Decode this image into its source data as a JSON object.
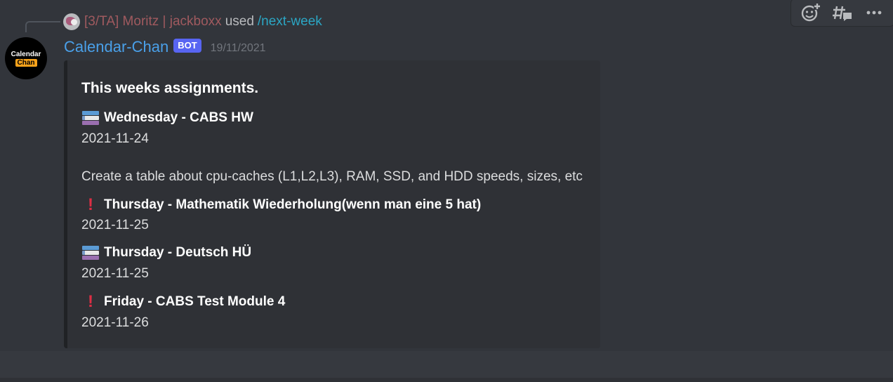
{
  "reply": {
    "user": "[3/TA] Moritz | jackboxx",
    "used_text": "used",
    "command": "/next-week"
  },
  "message": {
    "avatar_text_top": "Calendar",
    "avatar_text_bottom": "Chan",
    "username": "Calendar-Chan",
    "bot_tag": "BOT",
    "timestamp": "19/11/2021"
  },
  "embed": {
    "title": "This weeks assignments.",
    "fields": [
      {
        "icon": "books-icon",
        "name": "Wednesday - CABS HW",
        "value": "2021-11-24",
        "description": "Create a table about cpu-caches (L1,L2,L3), RAM, SSD, and HDD speeds, sizes, etc"
      },
      {
        "icon": "exclamation-icon",
        "name": "Thursday - Mathematik Wiederholung(wenn man eine 5 hat)",
        "value": "2021-11-25"
      },
      {
        "icon": "books-icon",
        "name": "Thursday - Deutsch HÜ",
        "value": "2021-11-25"
      },
      {
        "icon": "exclamation-icon",
        "name": "Friday - CABS Test Module 4",
        "value": "2021-11-26"
      }
    ]
  },
  "toolbar": {
    "buttons": [
      "add-reaction-icon",
      "create-thread-icon",
      "more-icon"
    ]
  },
  "colors": {
    "username": "#4aa0e9",
    "reply_user": "#a05a5f",
    "command": "#2ba6c4",
    "bot_tag": "#5865f2",
    "exclamation": "#dd2e44"
  }
}
